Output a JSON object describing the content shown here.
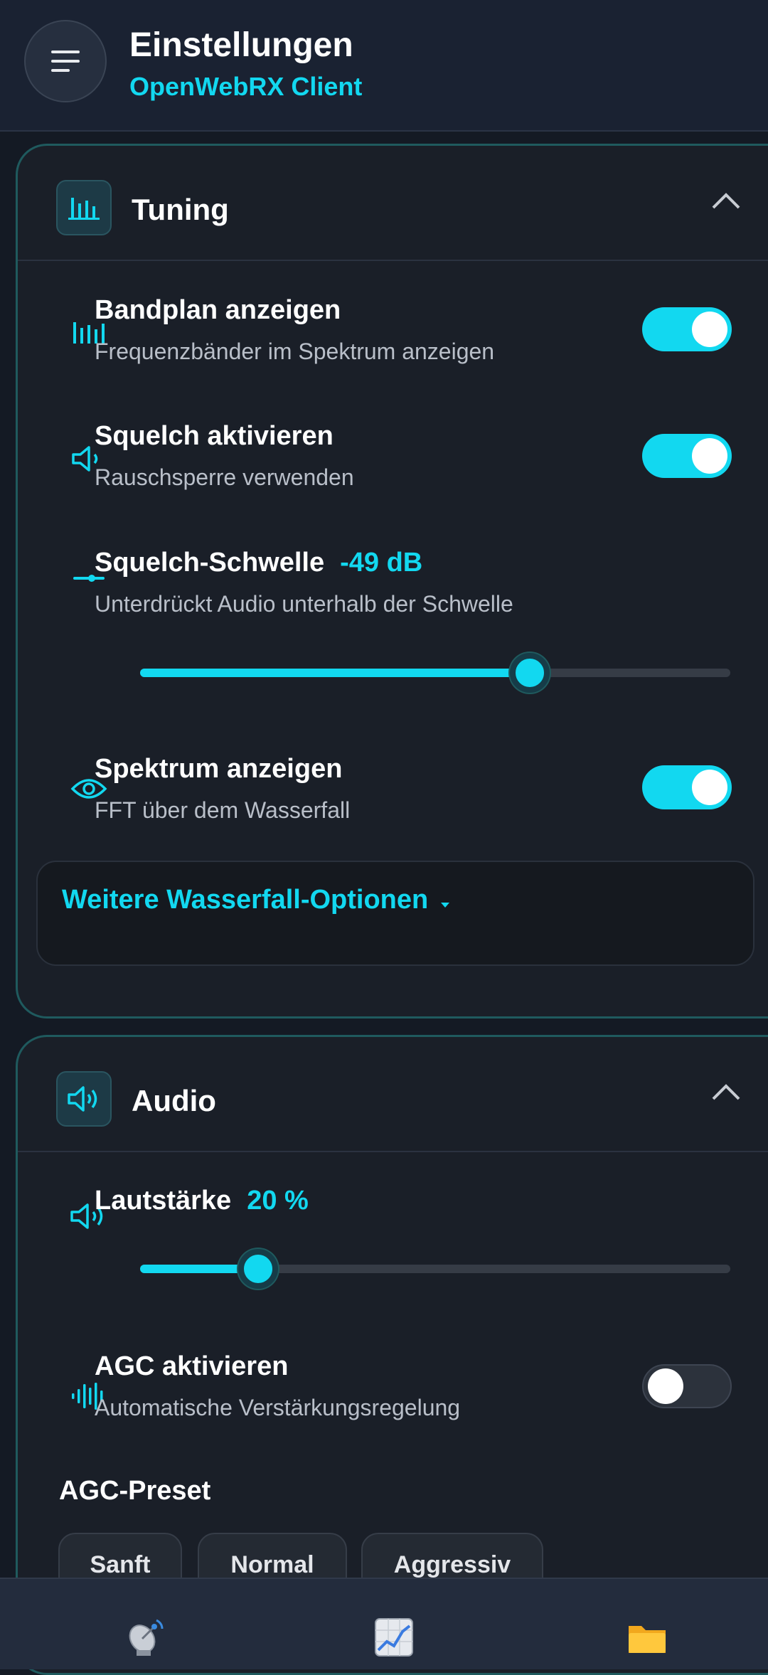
{
  "header": {
    "title": "Einstellungen",
    "subtitle": "OpenWebRX Client"
  },
  "tuning": {
    "title": "Tuning",
    "bandplan": {
      "title": "Bandplan anzeigen",
      "subtitle": "Frequenzbänder im Spektrum anzeigen",
      "enabled": true
    },
    "squelch": {
      "title": "Squelch aktivieren",
      "subtitle": "Rauschsperre verwenden",
      "enabled": true
    },
    "threshold": {
      "title": "Squelch-Schwelle",
      "value": "-49 dB",
      "subtitle": "Unterdrückt Audio unterhalb der Schwelle",
      "level": 0.66
    },
    "spectrum": {
      "title": "Spektrum anzeigen",
      "subtitle": "FFT über dem Wasserfall",
      "enabled": true
    },
    "more_options": "Weitere Wasserfall-Optionen"
  },
  "audio": {
    "title": "Audio",
    "volume": {
      "title": "Lautstärke",
      "value": "20 %",
      "level": 0.2
    },
    "agc": {
      "title": "AGC aktivieren",
      "subtitle": "Automatische Verstärkungsregelung",
      "enabled": false
    },
    "preset_label": "AGC-Preset",
    "presets": [
      "Sanft",
      "Normal",
      "Aggressiv"
    ]
  },
  "colors": {
    "accent": "#12d8f0",
    "background": "#141a24",
    "card": "#1a1f28"
  },
  "nav": [
    {
      "icon": "satellite-dish-icon"
    },
    {
      "icon": "chart-icon"
    },
    {
      "icon": "folder-icon"
    }
  ]
}
